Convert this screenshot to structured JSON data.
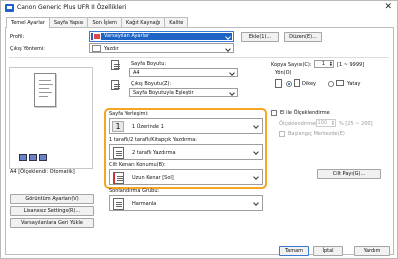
{
  "window": {
    "title": "Canon Generic Plus UFR II Özellikleri"
  },
  "tabs": [
    {
      "label": "Temel Ayarlar",
      "active": true
    },
    {
      "label": "Sayfa Yapısı",
      "active": false
    },
    {
      "label": "Son İşlem",
      "active": false
    },
    {
      "label": "Kağıt Kaynağı",
      "active": false
    },
    {
      "label": "Kalite",
      "active": false
    }
  ],
  "profile": {
    "label": "Profil:",
    "value": "Varsayılan Ayarlar",
    "add_button": "Ekle(1)...",
    "edit_button": "Düzen(E)..."
  },
  "output_method": {
    "label": "Çıkış Yöntemi:",
    "value": "Yazdır"
  },
  "page_size": {
    "label": "Sayfa Boyutu:",
    "value": "A4"
  },
  "output_size": {
    "label": "Çıkış Boyutu(Z):",
    "value": "Sayfa Boyutuyla Eşleştir"
  },
  "copies": {
    "label": "Kopya Sayısı(C):",
    "value": "1",
    "range": "[1 ~ 9999]"
  },
  "orientation": {
    "label": "Yön(O)",
    "portrait": "Dikey",
    "landscape": "Yatay",
    "selected": "portrait"
  },
  "page_layout": {
    "label": "Sayfa Yerleşimi:",
    "value": "1 Üzerinde 1",
    "icon_text": "1"
  },
  "print_style": {
    "label": "1 taraflı/2 taraflı/Kitapçık Yazdırma:",
    "value": "2 taraflı Yazdırma"
  },
  "binding": {
    "label": "Cilt Kenarı Konumu(B):",
    "value": "Uzun Kenar [Sol]"
  },
  "finishing": {
    "label": "Sonlandırma Grubu:",
    "value": "Harmanla"
  },
  "manual_scaling": {
    "label": "El ile Ölçeklendirme",
    "checked": false
  },
  "scaling": {
    "label": "Ölçeklendirme(L):",
    "value": "100",
    "range": "% [25 ~ 200]"
  },
  "center_page": {
    "label": "Başlangıç Merkezde(E)",
    "checked": false
  },
  "binding_button": "Cilt Payı(G)...",
  "preview": {
    "status": "A4 [Ölçeklendi: Otomatik]"
  },
  "left_buttons": {
    "view_settings": "Görüntüm Ayarları(V)",
    "license": "Lisanssız Settings(R)...",
    "defaults": "Varsayılanlara Geri Yükle"
  },
  "footer": {
    "ok": "Tamam",
    "cancel": "İptal",
    "help": "Yardım"
  },
  "colors": {
    "highlight": "#f5a623",
    "accent": "#1f63c4"
  }
}
